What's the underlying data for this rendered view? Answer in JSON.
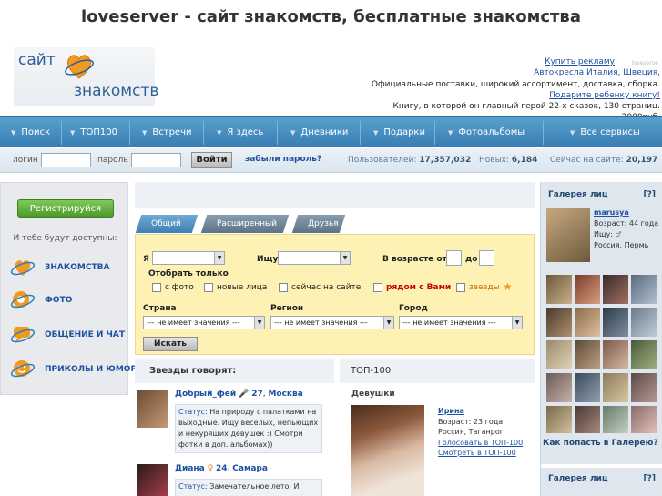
{
  "site": {
    "title": "loveserver - сайт знакомств, бесплатные знакомства",
    "logo_word1": "сайт",
    "logo_word2": "знакомств"
  },
  "ads": {
    "buy": "Купить рекламу",
    "tiny": "loveserve",
    "l1": "Автокресла Италия, Швеция,",
    "l2": "Официальные поставки, широкий ассортимент, доставка, сборка.",
    "l3": "Подарите ребенку книгу!",
    "l4": "Книгу, в которой он главный герой 22-х сказок, 130 страниц. 2000руб."
  },
  "nav": [
    "Поиск",
    "ТОП100",
    "Встречи",
    "Я здесь",
    "Дневники",
    "Подарки",
    "Фотоальбомы",
    "Все сервисы"
  ],
  "login": {
    "login_label": "логин",
    "password_label": "пароль",
    "button": "Войти",
    "forgot": "забыли пароль?",
    "users_label": "Пользователей:",
    "users": "17,357,032",
    "new_label": "Новых:",
    "new": "6,184",
    "online_label": "Сейчас на сайте:",
    "online": "20,197"
  },
  "left": {
    "register": "Регистрируйся",
    "available": "И тебе будут доступны:",
    "features": [
      {
        "label": "ЗНАКОМСТВА",
        "icon": "hearts-icon"
      },
      {
        "label": "ФОТО",
        "icon": "camera-icon"
      },
      {
        "label": "ОБЩЕНИЕ И ЧАТ",
        "icon": "chat-icon"
      },
      {
        "label": "ПРИКОЛЫ И ЮМОР",
        "icon": "smile-icon"
      }
    ]
  },
  "tabs": [
    "Общий",
    "Расширенный",
    "Друзья"
  ],
  "search": {
    "i_label": "Я",
    "seek_label": "Ищу",
    "age_label": "В возрасте от",
    "age_to": "до",
    "show_only": "Отобрать только",
    "checks": [
      "с фото",
      "новые лица",
      "сейчас на сайте",
      "рядом с Вами",
      "звезды"
    ],
    "country_label": "Страна",
    "region_label": "Регион",
    "city_label": "Город",
    "no_value": "--- не имеет значения ---",
    "button": "Искать"
  },
  "stars": {
    "heading": "Звезды говорят:",
    "items": [
      {
        "name": "Добрый_фей",
        "age": "27",
        "city": "Москва",
        "status_label": "Статус:",
        "status": "На природу с палатками на выходные. Ищу веселых, непьющих и некурящих девушек :) Смотри фотки в доп. альбомах))"
      },
      {
        "name": "Диана",
        "age": "24",
        "city": "Самара",
        "status_label": "Статус:",
        "status": "Замечательное лето. И"
      }
    ]
  },
  "top100": {
    "heading": "ТОП-100",
    "girls": "Девушки",
    "name": "Ирина",
    "age": "Возраст: 23 года",
    "location": "Россия, Таганрог",
    "vote": "Голосовать в ТОП-100",
    "view": "Смотреть в ТОП-100"
  },
  "gallery": {
    "heading": "Галерея лиц",
    "help": "[?]",
    "name": "marusya",
    "age": "Возраст: 44 года",
    "seek": "Ищу:",
    "location": "Россия, Пермь",
    "how": "Как попасть в Галерею?",
    "heading2": "Галерея лиц"
  },
  "colors": {
    "nav_blue": "#3a7eb3",
    "search_bg": "#fdf2b4",
    "link": "#1e50a2",
    "register_green": "#4f9a2c",
    "near_red": "#cc0000"
  }
}
